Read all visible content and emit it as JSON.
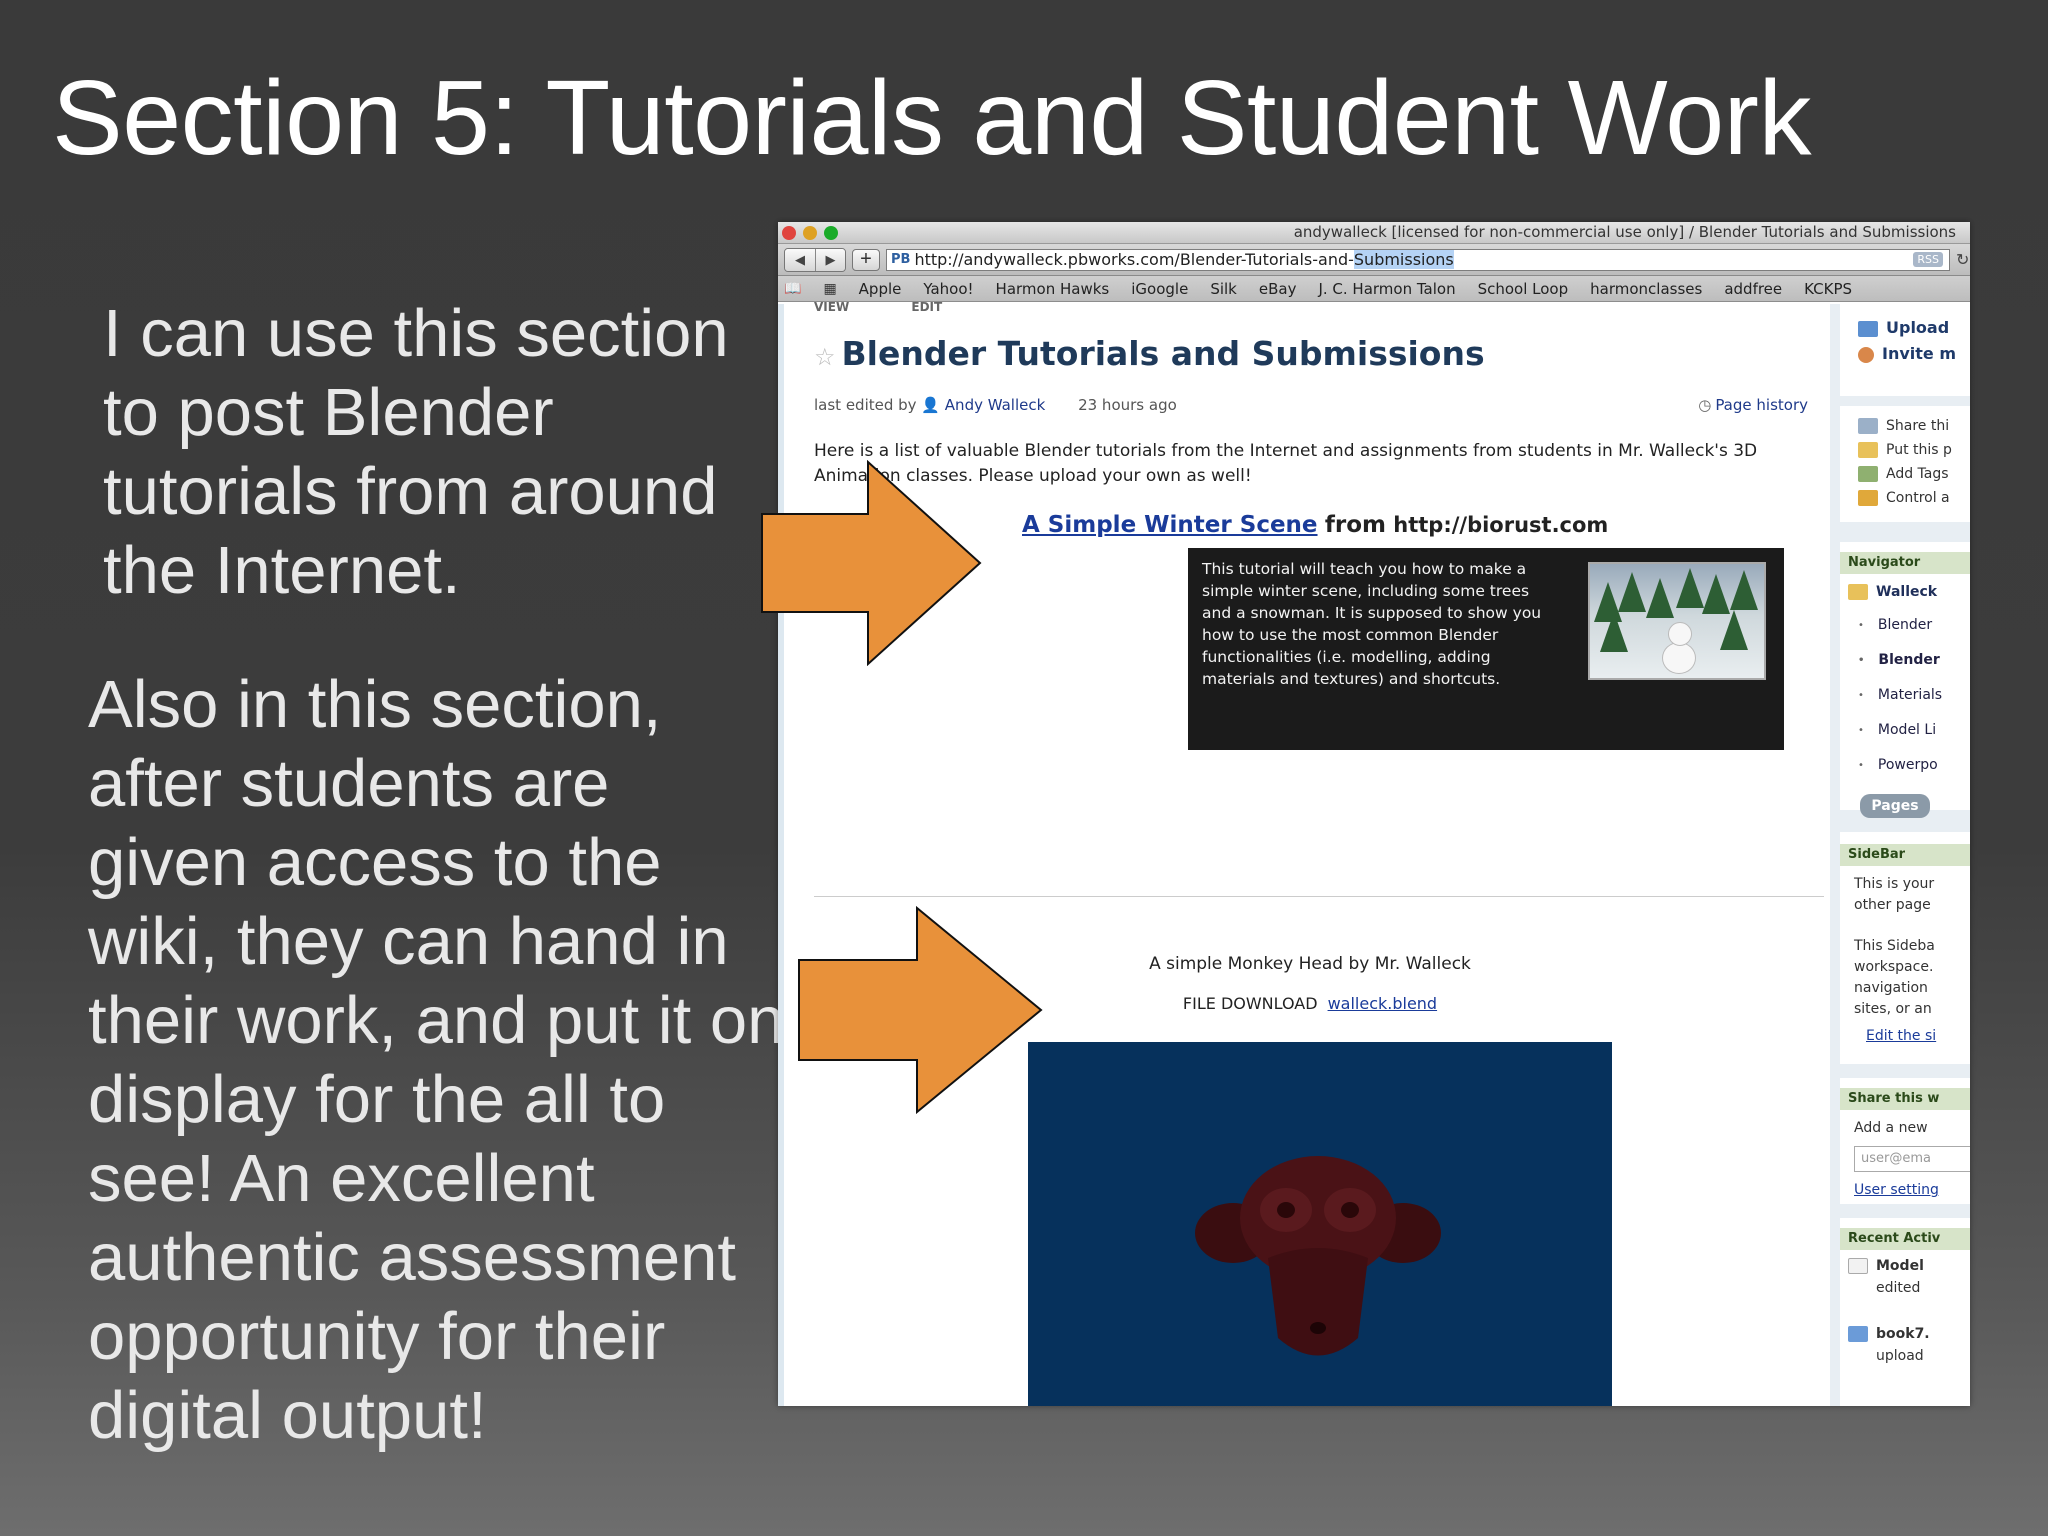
{
  "slide": {
    "title": "Section 5:  Tutorials and Student Work",
    "para1": "I can use this section to post Blender tutorials from around the Internet.",
    "para2": "Also in this section, after students are given access to the wiki, they can hand in their work, and put it on display for the all to see!  An excellent authentic assessment opportunity for their digital output!"
  },
  "browser": {
    "window_title": "andywalleck [licensed for non-commercial use only] / Blender Tutorials and Submissions",
    "url_prefix": "http://andywalleck.pbworks.com/Blender-Tutorials-and-",
    "url_highlight": "Submissions",
    "url_badge": "PB",
    "rss": "RSS",
    "bookmarks": [
      "Apple",
      "Yahoo!",
      "Harmon Hawks",
      "iGoogle",
      "Silk",
      "eBay",
      "J. C. Harmon Talon",
      "School Loop",
      "harmonclasses",
      "addfree",
      "KCKPS"
    ]
  },
  "page": {
    "tab_view": "VIEW",
    "tab_edit": "EDIT",
    "heading": "Blender Tutorials and Submissions",
    "last_edited_label": "last edited by",
    "author": "Andy Walleck",
    "edited_time": "23 hours ago",
    "page_history": "Page history",
    "intro": "Here is a list of valuable Blender tutorials from the Internet and assignments from students in Mr. Walleck's 3D Animation classes.  Please upload your own as well!",
    "tutorial": {
      "link": "A Simple Winter Scene",
      "from": "from",
      "source": "http://biorust.com",
      "description": "This tutorial will teach you how to make a simple winter scene, including some trees and a snowman. It is supposed to show you how to use the most common Blender functionalities (i.e. modelling, adding materials and textures) and shortcuts."
    },
    "monkey_title": "A simple Monkey Head by Mr. Walleck",
    "download_label": "FILE DOWNLOAD",
    "download_file": "walleck.blend"
  },
  "sidebar": {
    "upload": "Upload",
    "invite": "Invite m",
    "share": "Share thi",
    "put": "Put this p",
    "tags": "Add Tags",
    "control": "Control a",
    "navigator": "Navigator",
    "nav_folder": "Walleck",
    "nav_items": [
      "Blender",
      "Blender",
      "Materials",
      "Model Li",
      "Powerpo"
    ],
    "pages_btn": "Pages",
    "sidebar_hdr": "SideBar",
    "sb_text1": "This is your",
    "sb_text2": "other page",
    "sb_text3": "This Sideba",
    "sb_text4": "workspace.",
    "sb_text5": "navigation",
    "sb_text6": "sites, or an",
    "sb_edit": "Edit the si",
    "share_hdr": "Share this w",
    "add_new": "Add a new",
    "email_placeholder": "user@ema",
    "user_settings": "User setting",
    "recent_hdr": "Recent Activ",
    "recent1_title": "Model",
    "recent1_sub": "edited",
    "recent2_title": "book7.",
    "recent2_sub": "upload"
  },
  "colors": {
    "arrow": "#e8913a",
    "render_bg": "#06315c",
    "heading": "#1f3a5a",
    "link": "#1a3b9a"
  }
}
